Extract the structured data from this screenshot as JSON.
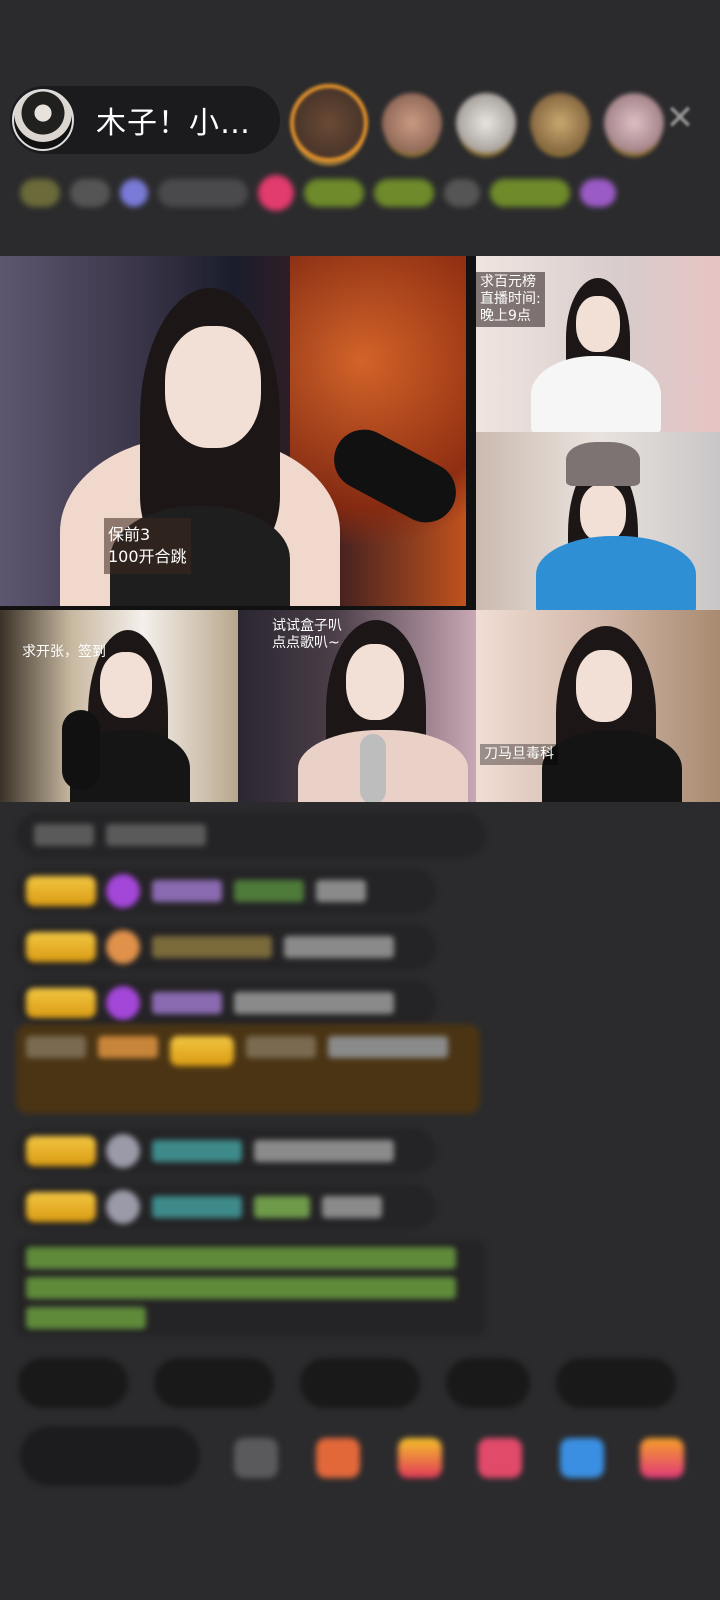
{
  "header": {
    "host_name": "木子！小…",
    "close_icon": "close-icon"
  },
  "streams": {
    "main_label": "保前3\n100开合跳",
    "top_right_label": "求百元榜\n直播时间:\n晚上9点",
    "bottom_left_label": "求开张，签到",
    "bottom_mid_label": "试试盒子叭\n点点歌叭~",
    "bottom_right_label": "刀马旦毒科"
  },
  "colors": {
    "background": "#2b2b2d",
    "badge_gold": "#e8b52a",
    "chat_bubble": "#242325",
    "highlight_message": "#4a3414",
    "green_text": "#6fae3a"
  }
}
